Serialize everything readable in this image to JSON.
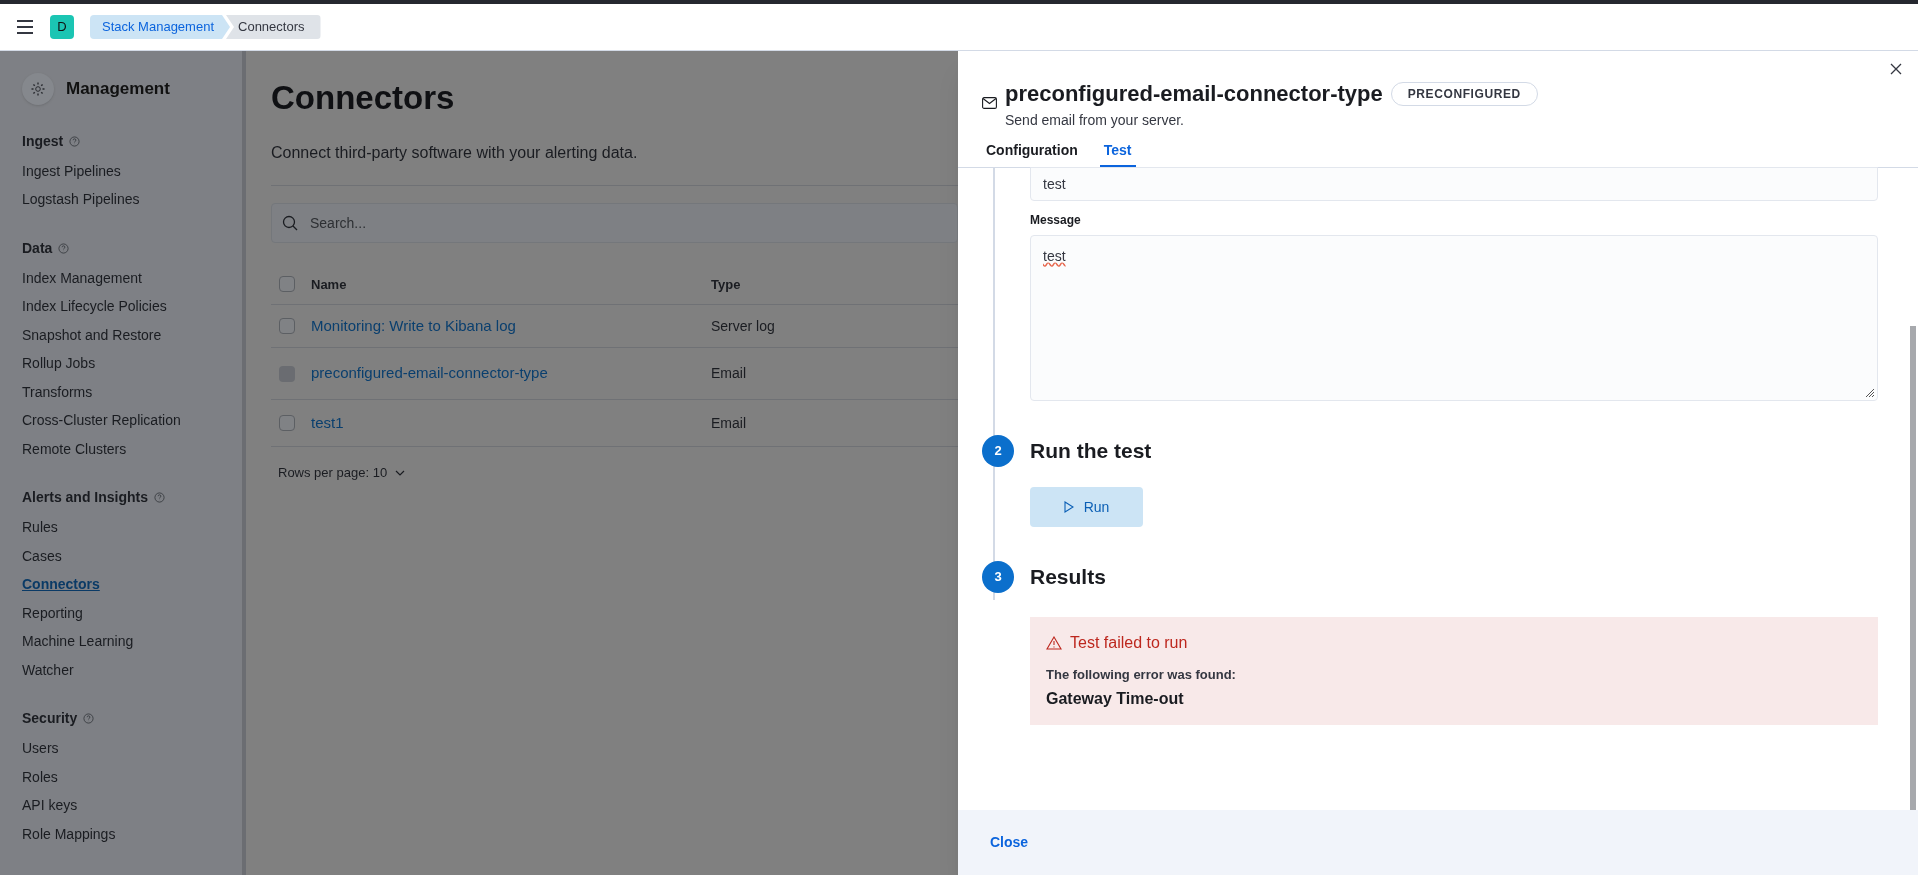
{
  "header": {
    "avatar": "D",
    "breadcrumbs": [
      {
        "label": "Stack Management",
        "selected": false
      },
      {
        "label": "Connectors",
        "selected": true
      }
    ]
  },
  "sidebar": {
    "title": "Management",
    "sections": [
      {
        "title": "Ingest",
        "items": [
          {
            "label": "Ingest Pipelines",
            "selected": false
          },
          {
            "label": "Logstash Pipelines",
            "selected": false
          }
        ]
      },
      {
        "title": "Data",
        "items": [
          {
            "label": "Index Management",
            "selected": false
          },
          {
            "label": "Index Lifecycle Policies",
            "selected": false
          },
          {
            "label": "Snapshot and Restore",
            "selected": false
          },
          {
            "label": "Rollup Jobs",
            "selected": false
          },
          {
            "label": "Transforms",
            "selected": false
          },
          {
            "label": "Cross-Cluster Replication",
            "selected": false
          },
          {
            "label": "Remote Clusters",
            "selected": false
          }
        ]
      },
      {
        "title": "Alerts and Insights",
        "items": [
          {
            "label": "Rules",
            "selected": false
          },
          {
            "label": "Cases",
            "selected": false
          },
          {
            "label": "Connectors",
            "selected": true
          },
          {
            "label": "Reporting",
            "selected": false
          },
          {
            "label": "Machine Learning",
            "selected": false
          },
          {
            "label": "Watcher",
            "selected": false
          }
        ]
      },
      {
        "title": "Security",
        "items": [
          {
            "label": "Users",
            "selected": false
          },
          {
            "label": "Roles",
            "selected": false
          },
          {
            "label": "API keys",
            "selected": false
          },
          {
            "label": "Role Mappings",
            "selected": false
          }
        ]
      }
    ]
  },
  "page": {
    "title": "Connectors",
    "description": "Connect third-party software with your alerting data.",
    "search": {
      "placeholder": "Search..."
    },
    "table": {
      "select_all": {
        "checked": false
      },
      "columns": [
        "Name",
        "Type"
      ],
      "rows": [
        {
          "name": "Monitoring: Write to Kibana log",
          "type": "Server log",
          "disabled": false
        },
        {
          "name": "preconfigured-email-connector-type",
          "type": "Email",
          "disabled": true
        },
        {
          "name": "test1",
          "type": "Email",
          "disabled": false
        }
      ]
    },
    "pagination": "Rows per page: 10"
  },
  "flyout": {
    "title": "preconfigured-email-connector-type",
    "badge": "PRECONFIGURED",
    "description": "Send email from your server.",
    "tabs": [
      {
        "label": "Configuration",
        "selected": false
      },
      {
        "label": "Test",
        "selected": true
      }
    ],
    "fields": [
      {
        "kind": "input",
        "value": "test"
      },
      {
        "kind": "textarea",
        "label": "Message",
        "value": "test"
      }
    ],
    "steps": [
      {
        "number": "2",
        "title": "Run the test",
        "button": "Run"
      },
      {
        "number": "3",
        "title": "Results"
      }
    ],
    "callout": {
      "title": "Test failed to run",
      "label": "The following error was found:",
      "error": "Gateway Time-out"
    },
    "footer": {
      "close": "Close"
    }
  }
}
